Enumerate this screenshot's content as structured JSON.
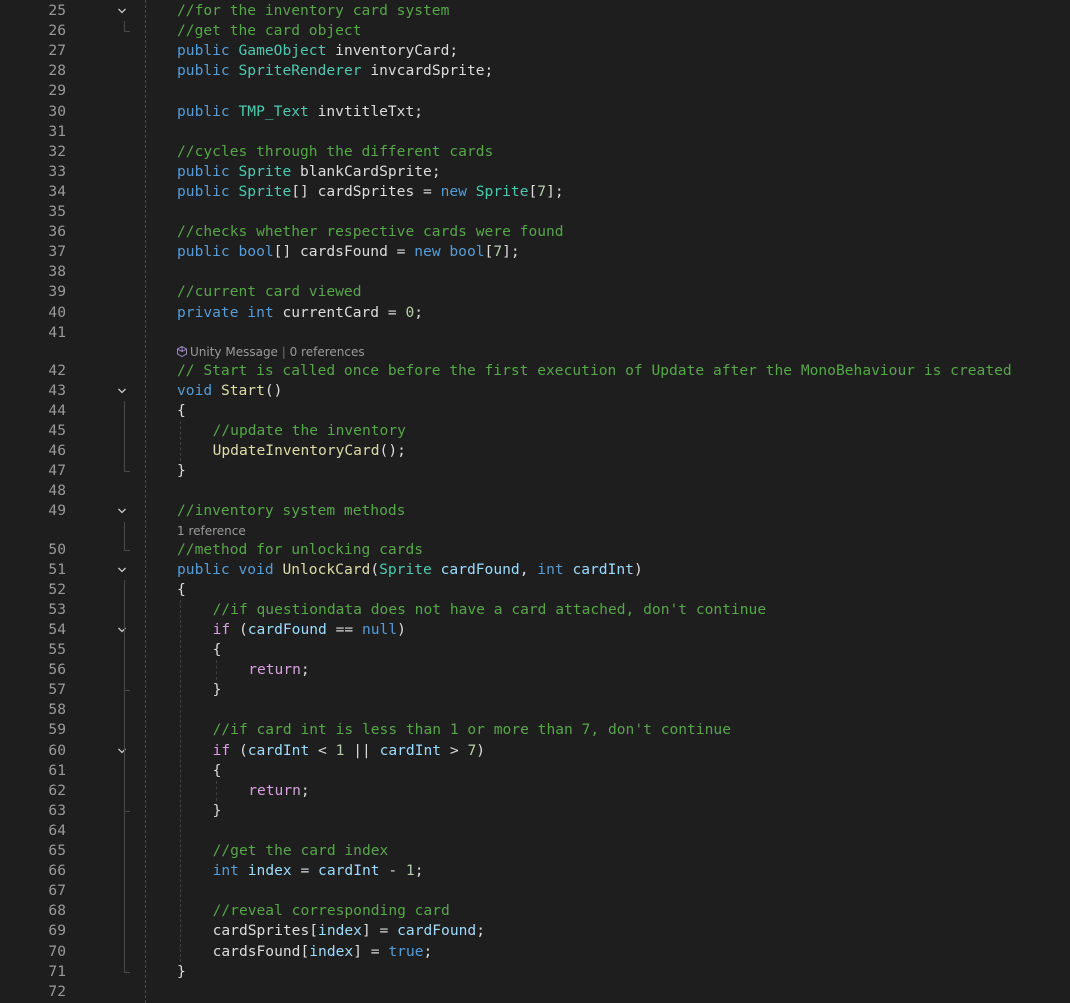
{
  "editor": {
    "lines": [
      {
        "n": "25",
        "fold": true,
        "indent": 0,
        "tokens": [
          [
            "cmt",
            "//for the inventory card system"
          ]
        ]
      },
      {
        "n": "26",
        "indent": 0,
        "tokens": [
          [
            "cmt",
            "//get the card object"
          ]
        ]
      },
      {
        "n": "27",
        "indent": 0,
        "tokens": [
          [
            "kw",
            "public "
          ],
          [
            "type",
            "GameObject"
          ],
          [
            "pl",
            " inventoryCard;"
          ]
        ]
      },
      {
        "n": "28",
        "indent": 0,
        "tokens": [
          [
            "kw",
            "public "
          ],
          [
            "type",
            "SpriteRenderer"
          ],
          [
            "pl",
            " invcardSprite;"
          ]
        ]
      },
      {
        "n": "29",
        "indent": 0,
        "tokens": []
      },
      {
        "n": "30",
        "indent": 0,
        "tokens": [
          [
            "kw",
            "public "
          ],
          [
            "type",
            "TMP_Text"
          ],
          [
            "pl",
            " invtitleTxt;"
          ]
        ]
      },
      {
        "n": "31",
        "indent": 0,
        "tokens": []
      },
      {
        "n": "32",
        "indent": 0,
        "tokens": [
          [
            "cmt",
            "//cycles through the different cards"
          ]
        ]
      },
      {
        "n": "33",
        "indent": 0,
        "tokens": [
          [
            "kw",
            "public "
          ],
          [
            "type",
            "Sprite"
          ],
          [
            "pl",
            " blankCardSprite;"
          ]
        ]
      },
      {
        "n": "34",
        "indent": 0,
        "tokens": [
          [
            "kw",
            "public "
          ],
          [
            "type",
            "Sprite"
          ],
          [
            "pl",
            "[] cardSprites = "
          ],
          [
            "kw",
            "new "
          ],
          [
            "type",
            "Sprite"
          ],
          [
            "pl",
            "["
          ],
          [
            "num",
            "7"
          ],
          [
            "pl",
            "];"
          ]
        ]
      },
      {
        "n": "35",
        "indent": 0,
        "tokens": []
      },
      {
        "n": "36",
        "indent": 0,
        "tokens": [
          [
            "cmt",
            "//checks whether respective cards were found"
          ]
        ]
      },
      {
        "n": "37",
        "indent": 0,
        "tokens": [
          [
            "kw",
            "public bool"
          ],
          [
            "pl",
            "[] cardsFound = "
          ],
          [
            "kw",
            "new bool"
          ],
          [
            "pl",
            "["
          ],
          [
            "num",
            "7"
          ],
          [
            "pl",
            "];"
          ]
        ]
      },
      {
        "n": "38",
        "indent": 0,
        "tokens": []
      },
      {
        "n": "39",
        "indent": 0,
        "tokens": [
          [
            "cmt",
            "//current card viewed"
          ]
        ]
      },
      {
        "n": "40",
        "indent": 0,
        "tokens": [
          [
            "kw",
            "private int"
          ],
          [
            "pl",
            " currentCard = "
          ],
          [
            "num",
            "0"
          ],
          [
            "pl",
            ";"
          ]
        ]
      },
      {
        "n": "41",
        "indent": 0,
        "tokens": []
      },
      {
        "n": "42",
        "indent": 0,
        "tokens": [
          [
            "cmt",
            "// Start is called once before the first execution of Update after the MonoBehaviour is created"
          ]
        ],
        "lens": {
          "icon": "unity-icon",
          "label": "Unity Message",
          "sep": " | ",
          "refs": "0 references"
        }
      },
      {
        "n": "43",
        "fold": true,
        "indent": 0,
        "tokens": [
          [
            "kw",
            "void "
          ],
          [
            "fn",
            "Start"
          ],
          [
            "pl",
            "()"
          ]
        ]
      },
      {
        "n": "44",
        "indent": 0,
        "tokens": [
          [
            "pl",
            "{"
          ]
        ]
      },
      {
        "n": "45",
        "indent": 1,
        "tokens": [
          [
            "cmt",
            "//update the inventory"
          ]
        ]
      },
      {
        "n": "46",
        "indent": 1,
        "tokens": [
          [
            "fn",
            "UpdateInventoryCard"
          ],
          [
            "pl",
            "();"
          ]
        ]
      },
      {
        "n": "47",
        "indent": 0,
        "tokens": [
          [
            "pl",
            "}"
          ]
        ]
      },
      {
        "n": "48",
        "indent": 0,
        "tokens": []
      },
      {
        "n": "49",
        "fold": true,
        "indent": 0,
        "tokens": [
          [
            "cmt",
            "//inventory system methods"
          ]
        ]
      },
      {
        "n": "50",
        "indent": 0,
        "tokens": [
          [
            "cmt",
            "//method for unlocking cards"
          ]
        ],
        "lens": {
          "icon": "",
          "label": "1 reference",
          "sep": "",
          "refs": ""
        }
      },
      {
        "n": "51",
        "fold": true,
        "indent": 0,
        "tokens": [
          [
            "kw",
            "public void "
          ],
          [
            "fn",
            "UnlockCard"
          ],
          [
            "pl",
            "("
          ],
          [
            "type",
            "Sprite"
          ],
          [
            "pl",
            " "
          ],
          [
            "param",
            "cardFound"
          ],
          [
            "pl",
            ", "
          ],
          [
            "kw",
            "int "
          ],
          [
            "param",
            "cardInt"
          ],
          [
            "pl",
            ")"
          ]
        ]
      },
      {
        "n": "52",
        "indent": 0,
        "tokens": [
          [
            "pl",
            "{"
          ]
        ]
      },
      {
        "n": "53",
        "indent": 1,
        "tokens": [
          [
            "cmt",
            "//if questiondata does not have a card attached, don't continue"
          ]
        ]
      },
      {
        "n": "54",
        "fold": true,
        "indent": 1,
        "tokens": [
          [
            "ctl",
            "if"
          ],
          [
            "pl",
            " ("
          ],
          [
            "param",
            "cardFound"
          ],
          [
            "pl",
            " == "
          ],
          [
            "kw",
            "null"
          ],
          [
            "pl",
            ")"
          ]
        ]
      },
      {
        "n": "55",
        "indent": 1,
        "tokens": [
          [
            "pl",
            "{"
          ]
        ]
      },
      {
        "n": "56",
        "indent": 2,
        "tokens": [
          [
            "ctl",
            "return"
          ],
          [
            "pl",
            ";"
          ]
        ]
      },
      {
        "n": "57",
        "indent": 1,
        "tokens": [
          [
            "pl",
            "}"
          ]
        ]
      },
      {
        "n": "58",
        "indent": 1,
        "tokens": []
      },
      {
        "n": "59",
        "indent": 1,
        "tokens": [
          [
            "cmt",
            "//if card int is less than 1 or more than 7, don't continue"
          ]
        ]
      },
      {
        "n": "60",
        "fold": true,
        "indent": 1,
        "tokens": [
          [
            "ctl",
            "if"
          ],
          [
            "pl",
            " ("
          ],
          [
            "param",
            "cardInt"
          ],
          [
            "pl",
            " < "
          ],
          [
            "num",
            "1"
          ],
          [
            "pl",
            " || "
          ],
          [
            "param",
            "cardInt"
          ],
          [
            "pl",
            " > "
          ],
          [
            "num",
            "7"
          ],
          [
            "pl",
            ")"
          ]
        ]
      },
      {
        "n": "61",
        "indent": 1,
        "tokens": [
          [
            "pl",
            "{"
          ]
        ]
      },
      {
        "n": "62",
        "indent": 2,
        "tokens": [
          [
            "ctl",
            "return"
          ],
          [
            "pl",
            ";"
          ]
        ]
      },
      {
        "n": "63",
        "indent": 1,
        "tokens": [
          [
            "pl",
            "}"
          ]
        ]
      },
      {
        "n": "64",
        "indent": 1,
        "tokens": []
      },
      {
        "n": "65",
        "indent": 1,
        "tokens": [
          [
            "cmt",
            "//get the card index"
          ]
        ]
      },
      {
        "n": "66",
        "indent": 1,
        "tokens": [
          [
            "kw",
            "int "
          ],
          [
            "param",
            "index"
          ],
          [
            "pl",
            " = "
          ],
          [
            "param",
            "cardInt"
          ],
          [
            "pl",
            " - "
          ],
          [
            "num",
            "1"
          ],
          [
            "pl",
            ";"
          ]
        ]
      },
      {
        "n": "67",
        "indent": 1,
        "tokens": []
      },
      {
        "n": "68",
        "indent": 1,
        "tokens": [
          [
            "cmt",
            "//reveal corresponding card"
          ]
        ]
      },
      {
        "n": "69",
        "indent": 1,
        "tokens": [
          [
            "pl",
            "cardSprites["
          ],
          [
            "param",
            "index"
          ],
          [
            "pl",
            "] = "
          ],
          [
            "param",
            "cardFound"
          ],
          [
            "pl",
            ";"
          ]
        ]
      },
      {
        "n": "70",
        "indent": 1,
        "tokens": [
          [
            "pl",
            "cardsFound["
          ],
          [
            "param",
            "index"
          ],
          [
            "pl",
            "] = "
          ],
          [
            "kw",
            "true"
          ],
          [
            "pl",
            ";"
          ]
        ]
      },
      {
        "n": "71",
        "indent": 0,
        "tokens": [
          [
            "pl",
            "}"
          ]
        ]
      },
      {
        "n": "72",
        "indent": 0,
        "tokens": []
      }
    ]
  },
  "colors": {
    "background": "#1e1e1e",
    "keyword": "#569cd6",
    "control": "#d8a0df",
    "type": "#4ec9b0",
    "method": "#dcdcaa",
    "parameter": "#9cdcfe",
    "comment": "#57a64a",
    "number": "#b5cea8",
    "plain": "#dcdcdc",
    "line_number": "#9a9a9a"
  }
}
